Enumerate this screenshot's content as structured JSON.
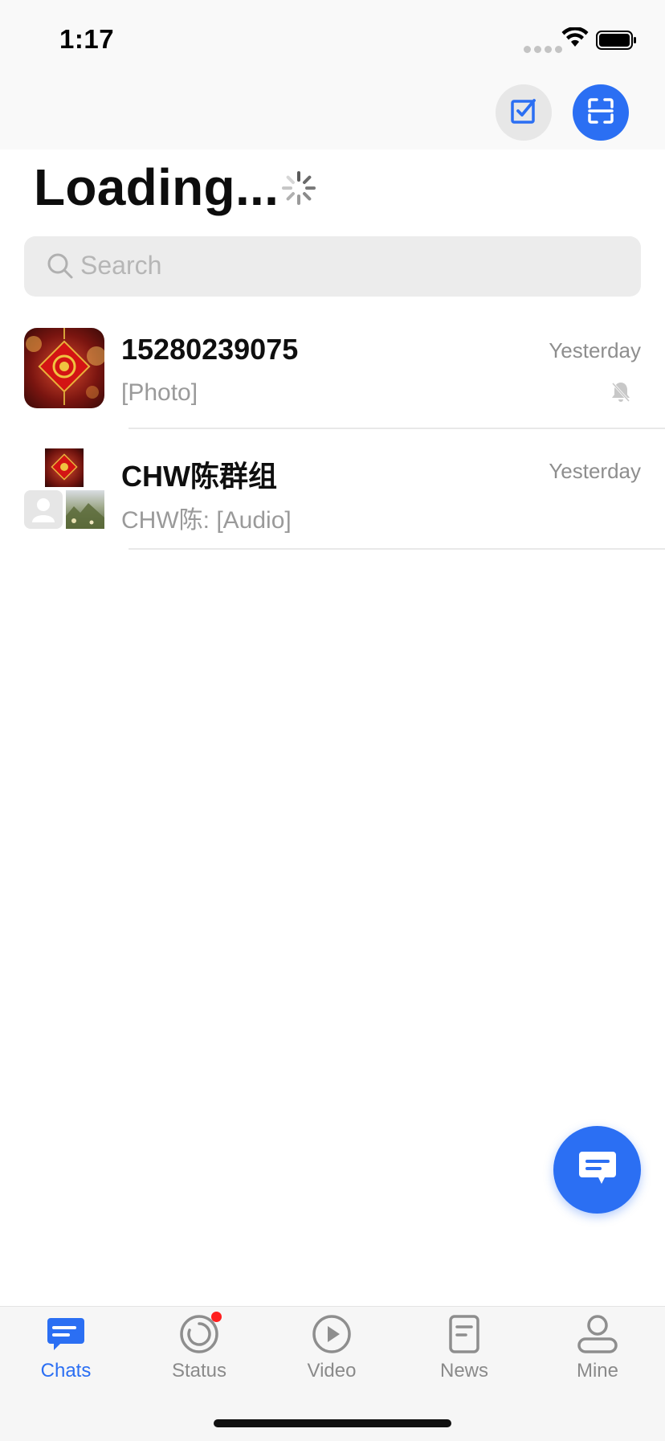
{
  "status_bar": {
    "time": "1:17"
  },
  "header": {
    "title": "Loading...",
    "actions": {
      "tasks_icon": "checkbox-icon",
      "scan_icon": "scan-icon"
    }
  },
  "search": {
    "placeholder": "Search"
  },
  "chats": [
    {
      "name": "15280239075",
      "time": "Yesterday",
      "preview": "[Photo]",
      "muted": true
    },
    {
      "name": "CHW陈群组",
      "time": "Yesterday",
      "preview": "CHW陈: [Audio]",
      "muted": false
    }
  ],
  "fab": {
    "icon": "new-chat-icon"
  },
  "tabs": [
    {
      "label": "Chats",
      "icon": "chat-bubble-icon",
      "active": true
    },
    {
      "label": "Status",
      "icon": "status-ring-icon",
      "badge": true
    },
    {
      "label": "Video",
      "icon": "play-circle-icon"
    },
    {
      "label": "News",
      "icon": "document-icon"
    },
    {
      "label": "Mine",
      "icon": "person-icon"
    }
  ],
  "colors": {
    "accent": "#2b6ff3",
    "badge": "#ff1f1f",
    "muted_text": "#9a9a9a"
  }
}
